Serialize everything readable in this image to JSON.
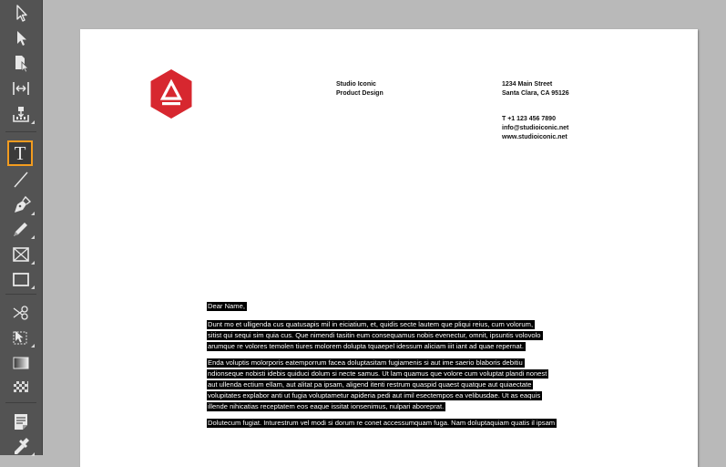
{
  "toolbar": {
    "tools": [
      {
        "name": "selection-tool-icon"
      },
      {
        "name": "direct-selection-tool-icon"
      },
      {
        "name": "page-tool-icon"
      },
      {
        "name": "gap-tool-icon"
      },
      {
        "name": "content-collector-tool-icon"
      },
      {
        "name": "type-tool-icon",
        "active": true
      },
      {
        "name": "line-tool-icon"
      },
      {
        "name": "pen-tool-icon"
      },
      {
        "name": "pencil-tool-icon"
      },
      {
        "name": "rectangle-frame-tool-icon"
      },
      {
        "name": "rectangle-tool-icon"
      },
      {
        "name": "scissors-tool-icon"
      },
      {
        "name": "free-transform-tool-icon"
      },
      {
        "name": "gradient-swatch-tool-icon"
      },
      {
        "name": "gradient-feather-tool-icon"
      },
      {
        "name": "note-tool-icon"
      },
      {
        "name": "eyedropper-tool-icon"
      }
    ],
    "type_glyph": "T"
  },
  "colors": {
    "accent": "#f39c1f",
    "logo": "#d7272f",
    "toolbar": "#535353",
    "pasteboard": "#b9b9b9",
    "selection": "#000000"
  },
  "letterhead": {
    "company": [
      "Studio Iconic",
      "Product Design"
    ],
    "address": [
      "1234 Main Street",
      "Santa Clara, CA 95126"
    ],
    "contact": [
      "T +1 123 456 7890",
      "info@studioiconic.net",
      "www.studioiconic.net"
    ]
  },
  "letter": {
    "greeting": "Dear Name,",
    "paragraph1": [
      "Dunt mo et ulligenda cus quatusapis mil in eiciatium, et, quidis secte lautem que pliqui reius, cum volorum,",
      "sitist qui sequi sim quia cus. Que nimendi tasitin eum consequamus nobis evenectur, omnit, ipsuntis volovolo",
      "arumque re volores temolen tiures molorem dolupta tquaepel idessum aliciam iiit iant ad quae repernat."
    ],
    "paragraph2": [
      "Enda voluptis molorporis eatemporrum facea doluptasitam fugiamenis si aut ime saerio blaboris debitiu",
      "ndionseque nobisti idebis quiduci dolum si necte samus. Ut lam quamus que volore cum voluptat plandi nonest",
      "aut ullenda ectium ellam, aut alitat pa ipsam, aligend itenti restrum quaspid quaest quatque aut quiaectate",
      "volupitates explabor anti ut fugia voluptametur apideria pedi aut imil esectempos ea velibusdae. Ut as eaquis",
      "illende nihicatias receptatem eos eaque issitat ionsenimus, nulpari aboreprat."
    ],
    "paragraph3": [
      "Dolutecum fugiat. Inturestrum vel modi si dorum re conet accessumquam fuga. Nam doluptaquiam quatis il ipsam"
    ]
  }
}
